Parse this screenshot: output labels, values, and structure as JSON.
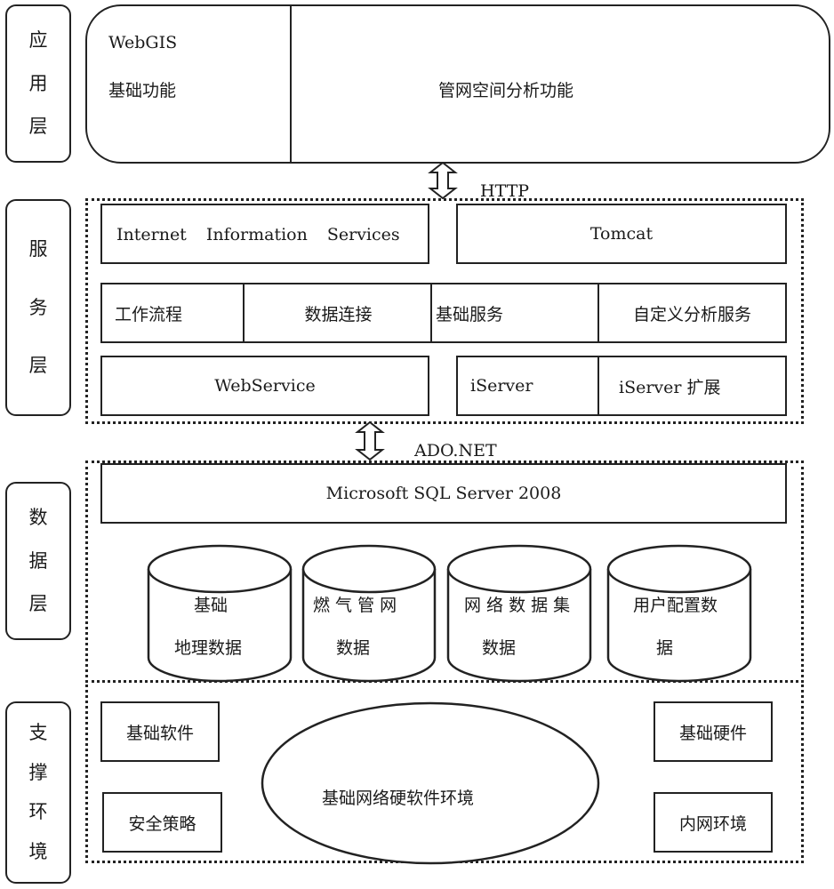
{
  "layers": {
    "application": [
      "应",
      "用",
      "层"
    ],
    "service": [
      "服",
      "务",
      "层"
    ],
    "data": [
      "数",
      "据",
      "层"
    ],
    "support": [
      "支",
      "撑",
      "环",
      "境"
    ]
  },
  "application": {
    "webgis_line1": "WebGIS",
    "webgis_line2": "基础功能",
    "network_analysis": "管网空间分析功能"
  },
  "connectors": {
    "http": "HTTP",
    "adonet": "ADO.NET"
  },
  "service": {
    "iis": [
      "Internet",
      "Information",
      "Services"
    ],
    "tomcat": "Tomcat",
    "row2": [
      "工作流程",
      "数据连接",
      "基础服务",
      "自定义分析服务"
    ],
    "webservice": "WebService",
    "iserver": "iServer",
    "iserver_ext": "iServer 扩展"
  },
  "data": {
    "sqlserver": "Microsoft SQL Server 2008",
    "databases": [
      {
        "line1": "基础",
        "line2": "地理数据"
      },
      {
        "line1": "燃 气 管 网",
        "line2": "数据"
      },
      {
        "line1": "网 络 数 据 集",
        "line2": "数据"
      },
      {
        "line1": "用户配置数",
        "line2": "据"
      }
    ]
  },
  "support": {
    "basic_software": "基础软件",
    "security_policy": "安全策略",
    "center": "基础网络硬软件环境",
    "basic_hardware": "基础硬件",
    "intranet": "内网环境"
  }
}
